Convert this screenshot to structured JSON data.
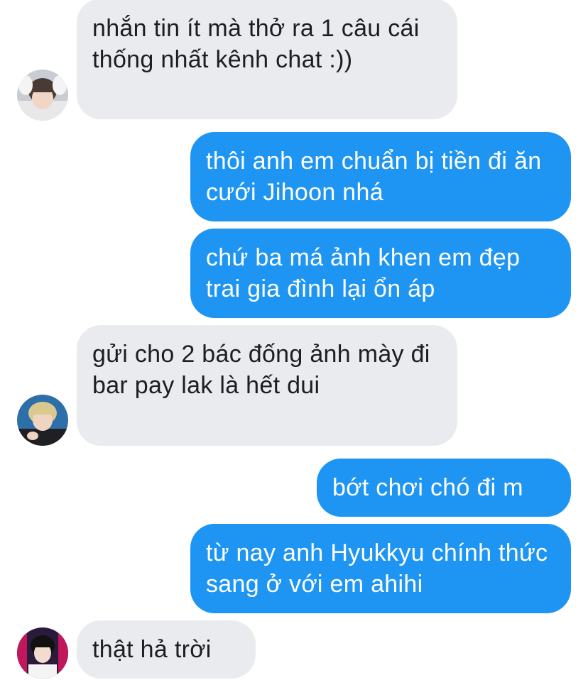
{
  "messages": [
    {
      "direction": "incoming",
      "text": "nhắn tin ít mà thở ra 1 câu cái thống nhất kênh chat :))",
      "avatar": "avatar-1"
    },
    {
      "direction": "outgoing",
      "text": "thôi anh em chuẩn bị tiền đi ăn cưới Jihoon nhá"
    },
    {
      "direction": "outgoing",
      "text": "chứ ba má ảnh khen em đẹp trai gia đình lại ổn áp"
    },
    {
      "direction": "incoming",
      "text": "gửi cho 2 bác đống ảnh mày đi bar pay lak là hết dui",
      "avatar": "avatar-2"
    },
    {
      "direction": "outgoing",
      "text": "bớt chơi chó đi m"
    },
    {
      "direction": "outgoing",
      "text": "từ nay anh Hyukkyu chính thức sang ở với em ahihi"
    },
    {
      "direction": "incoming",
      "text": "thật hả trời",
      "avatar": "avatar-3"
    }
  ],
  "colors": {
    "incoming_bubble": "#e9ebee",
    "incoming_text": "#1c1e21",
    "outgoing_bubble": "#1e95f3",
    "outgoing_text": "#ffffff"
  }
}
